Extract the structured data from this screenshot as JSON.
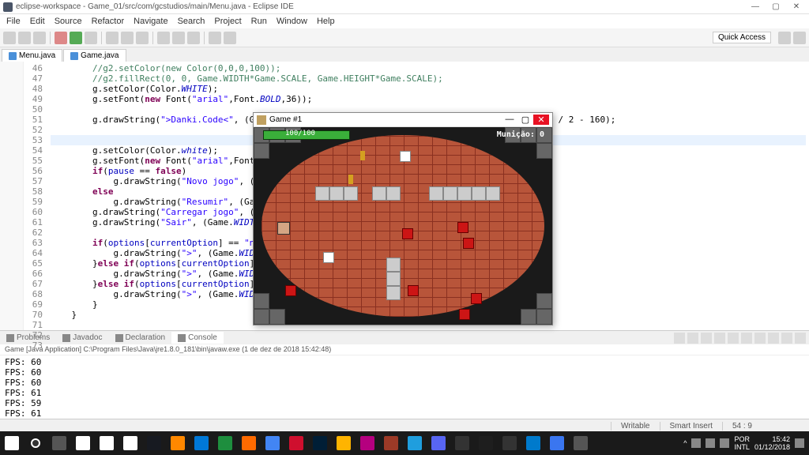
{
  "window": {
    "title": "eclipse-workspace - Game_01/src/com/gcstudios/main/Menu.java - Eclipse IDE"
  },
  "menubar": [
    "File",
    "Edit",
    "Source",
    "Refactor",
    "Navigate",
    "Search",
    "Project",
    "Run",
    "Window",
    "Help"
  ],
  "quick_access": "Quick Access",
  "tabs": [
    {
      "label": "Menu.java"
    },
    {
      "label": "Game.java"
    }
  ],
  "gutter_lines": [
    "46",
    "47",
    "48",
    "49",
    "50",
    "51",
    "52",
    "53",
    "54",
    "55",
    "56",
    "57",
    "58",
    "59",
    "60",
    "61",
    "62",
    "63",
    "64",
    "65",
    "66",
    "67",
    "68",
    "69",
    "70",
    "71",
    "72",
    "73"
  ],
  "code_lines": [
    {
      "html": "        <span class='com'>//g2.setColor(new Color(0,0,0,100));</span>"
    },
    {
      "html": "        <span class='com'>//g2.fillRect(0, 0, Game.WIDTH*Game.SCALE, Game.HEIGHT*Game.SCALE);</span>"
    },
    {
      "html": "        g.setColor(Color.<span class='fldi'>WHITE</span>);"
    },
    {
      "html": "        g.setFont(<span class='kw'>new</span> Font(<span class='str'>\"arial\"</span>,Font.<span class='fldi'>BOLD</span>,36));"
    },
    {
      "html": ""
    },
    {
      "html": "        g.drawString(<span class='str'>\"&gt;Danki.Code&lt;\"</span>, (Game.<span class='fldi'>WIDTH</span>*Game.<span class='fldi'>SCALE</span>) / 2 - 110, (Game.<span class='fldi'>HEIGHT</span>*Game.<span class='fldi'>SCALE</span>) / 2 - 160);"
    },
    {
      "html": ""
    },
    {
      "html": "<span class='highlight-line'>        </span>"
    },
    {
      "html": "        g.setColor(Color.<span class='fldi'>white</span>);"
    },
    {
      "html": "        g.setFont(<span class='kw'>new</span> Font(<span class='str'>\"arial\"</span>,Font.<span class='fldi'>BOLD</span>,2"
    },
    {
      "html": "        <span class='kw'>if</span>(<span class='fld'>pause</span> == <span class='kw'>false</span>)"
    },
    {
      "html": "            g.drawString(<span class='str'>\"Novo jogo\"</span>, (Game.<span class='fldi'>WI</span>"
    },
    {
      "html": "        <span class='kw'>else</span>"
    },
    {
      "html": "            g.drawString(<span class='str'>\"Resumir\"</span>, (Game.<span class='fldi'>WIDT</span>"
    },
    {
      "html": "        g.drawString(<span class='str'>\"Carregar jogo\"</span>, (Game.<span class='fldi'>WI</span>"
    },
    {
      "html": "        g.drawString(<span class='str'>\"Sair\"</span>, (Game.<span class='fldi'>WIDTH</span>*Game."
    },
    {
      "html": ""
    },
    {
      "html": "        <span class='kw'>if</span>(<span class='fld'>options</span>[<span class='fld'>currentOption</span>] == <span class='str'>\"novo jo</span>"
    },
    {
      "html": "            g.drawString(<span class='str'>\"&gt;\"</span>, (Game.<span class='fldi'>WIDTH</span>*Game"
    },
    {
      "html": "        }<span class='kw'>else if</span>(<span class='fld'>options</span>[<span class='fld'>currentOption</span>] == <span class='str'>\"ca</span>"
    },
    {
      "html": "            g.drawString(<span class='str'>\"&gt;\"</span>, (Game.<span class='fldi'>WIDTH</span>*Game"
    },
    {
      "html": "        }<span class='kw'>else if</span>(<span class='fld'>options</span>[<span class='fld'>currentOption</span>] == <span class='str'>\"sa</span>"
    },
    {
      "html": "            g.drawString(<span class='str'>\"&gt;\"</span>, (Game.<span class='fldi'>WIDTH</span>*Game"
    },
    {
      "html": "        }"
    },
    {
      "html": "    }"
    },
    {
      "html": ""
    },
    {
      "html": "}"
    }
  ],
  "game": {
    "title": "Game #1",
    "hp": "100/100",
    "ammo": "Munição: 0"
  },
  "bottom_tabs": [
    "Problems",
    "Javadoc",
    "Declaration",
    "Console"
  ],
  "console_header": "Game [Java Application] C:\\Program Files\\Java\\jre1.8.0_181\\bin\\javaw.exe (1 de dez de 2018 15:42:48)",
  "console_lines": [
    "FPS: 60",
    "FPS: 60",
    "FPS: 60",
    "FPS: 61",
    "FPS: 59",
    "FPS: 61"
  ],
  "status": {
    "writable": "Writable",
    "insert": "Smart Insert",
    "pos": "54 : 9"
  },
  "tray": {
    "lang": "POR\nINTL",
    "time": "15:42",
    "date": "01/12/2018"
  },
  "taskbar_colors": [
    "#fff",
    "#fff",
    "#fff",
    "#171a21",
    "#ff8800",
    "#0078d7",
    "#1e8e3e",
    "#ff6a00",
    "#4285f4",
    "#cf0f2e",
    "#001e36",
    "#ffb400",
    "#b5007f",
    "#9c3a27",
    "#1f9ede",
    "#5865f2",
    "#333",
    "#1e1e1e",
    "#333",
    "#007acc",
    "#3a76f0",
    "#555"
  ]
}
